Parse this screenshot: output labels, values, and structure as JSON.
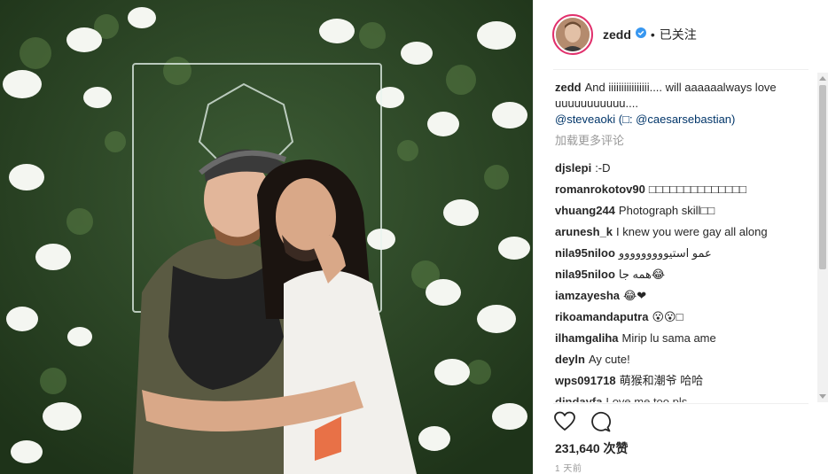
{
  "post": {
    "username": "zedd",
    "dot": "•",
    "follow_label": "已关注",
    "caption": {
      "user": "zedd",
      "text": "And iiiiiiiiiiiiiiii.... will aaaaaalways love uuuuuuuuuuu....",
      "mention": "@steveaoki",
      "credit_open": " (",
      "credit_glyph": "□",
      "credit_mid": ": ",
      "credit_mention": "@caesarsebastian",
      "credit_close": ")"
    },
    "load_more": "加载更多评论",
    "comments": [
      {
        "user": "djslepi",
        "text": ":-D"
      },
      {
        "user": "romanrokotov90",
        "text": "□□□□□□□□□□□□□□"
      },
      {
        "user": "vhuang244",
        "text": "Photograph skill□□"
      },
      {
        "user": "arunesh_k",
        "text": "I knew you were gay all along"
      },
      {
        "user": "nila95niloo",
        "text": "عمو استيووووووووو"
      },
      {
        "user": "nila95niloo",
        "text": "همه جا😂"
      },
      {
        "user": "iamzayesha",
        "text": "😂❤"
      },
      {
        "user": "rikoamandaputra",
        "text": "😮😮□"
      },
      {
        "user": "ilhamgaliha",
        "text": "Mirip lu sama ame"
      },
      {
        "user": "deyln",
        "text": "Ay cute!"
      },
      {
        "user": "wps091718",
        "text": "萌猴和潮爷 哈哈"
      },
      {
        "user": "dindayfa",
        "text": "Love me too pls"
      }
    ],
    "likes": "231,640 次赞",
    "time": "1 天前",
    "icons": {
      "verified": "verified-badge-icon",
      "like": "heart-icon",
      "comment": "comment-bubble-icon"
    },
    "colors": {
      "link": "#003569",
      "verified": "#3897f0",
      "muted": "#999999",
      "avatar_ring": "#e1306c"
    }
  }
}
